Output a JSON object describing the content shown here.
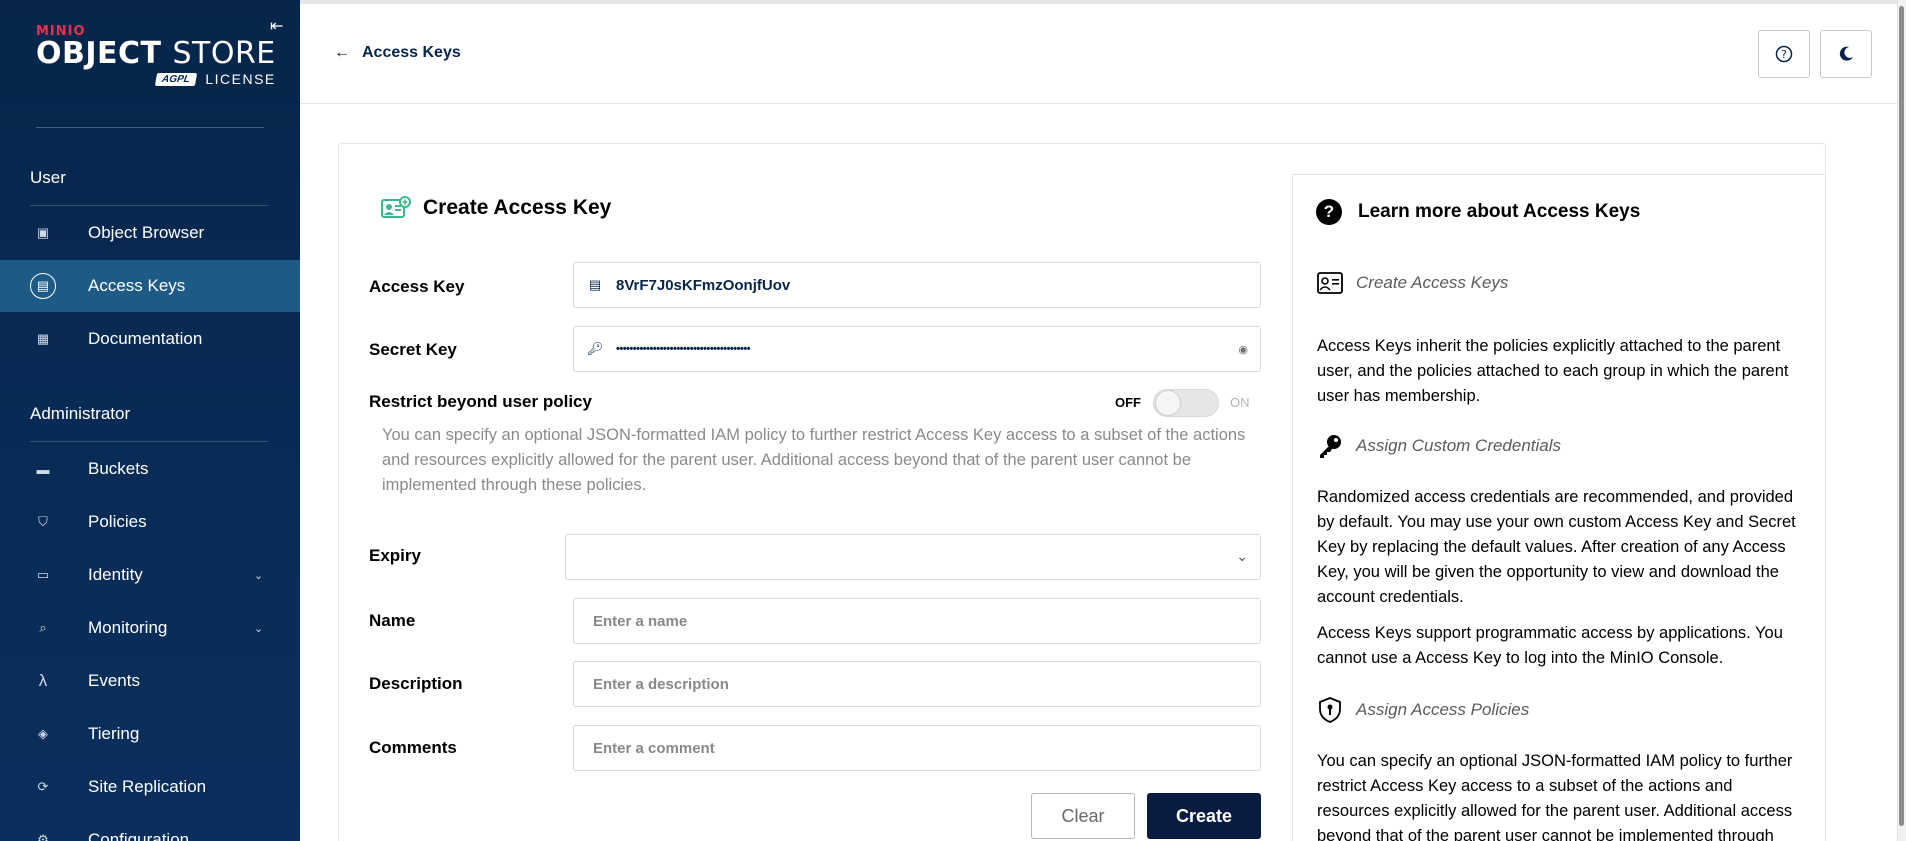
{
  "sidebar": {
    "logo": {
      "brand": "MINIO",
      "product_bold": "OBJECT",
      "product_light": "STORE",
      "badge": "AGPL",
      "license": "LICENSE"
    },
    "sections": {
      "user": "User",
      "admin": "Administrator"
    },
    "items": [
      {
        "label": "Object Browser",
        "icon": "object-browser-icon"
      },
      {
        "label": "Access Keys",
        "icon": "access-keys-icon",
        "active": true
      },
      {
        "label": "Documentation",
        "icon": "documentation-icon"
      },
      {
        "label": "Buckets",
        "icon": "bucket-icon"
      },
      {
        "label": "Policies",
        "icon": "shield-icon"
      },
      {
        "label": "Identity",
        "icon": "identity-icon",
        "expandable": true
      },
      {
        "label": "Monitoring",
        "icon": "monitoring-icon",
        "expandable": true
      },
      {
        "label": "Events",
        "icon": "lambda-icon"
      },
      {
        "label": "Tiering",
        "icon": "layers-icon"
      },
      {
        "label": "Site Replication",
        "icon": "replication-icon"
      },
      {
        "label": "Configuration",
        "icon": "gear-icon"
      }
    ]
  },
  "header": {
    "back_label": "Access Keys"
  },
  "form": {
    "title": "Create Access Key",
    "access_key": {
      "label": "Access Key",
      "value": "8VrF7J0sKFmzOonjfUov"
    },
    "secret_key": {
      "label": "Secret Key",
      "value": "••••••••••••••••••••••••••••••••••••••••"
    },
    "restrict": {
      "label": "Restrict beyond user policy",
      "off_label": "OFF",
      "on_label": "ON",
      "help": "You can specify an optional JSON-formatted IAM policy to further restrict Access Key access to a subset of the actions and resources explicitly allowed for the parent user. Additional access beyond that of the parent user cannot be implemented through these policies."
    },
    "expiry": {
      "label": "Expiry",
      "value": ""
    },
    "name": {
      "label": "Name",
      "placeholder": "Enter a name"
    },
    "description": {
      "label": "Description",
      "placeholder": "Enter a description"
    },
    "comments": {
      "label": "Comments",
      "placeholder": "Enter a comment"
    },
    "clear_label": "Clear",
    "create_label": "Create"
  },
  "help": {
    "title": "Learn more about Access Keys",
    "sections": [
      {
        "heading": "Create Access Keys",
        "paragraphs": [
          "Access Keys inherit the policies explicitly attached to the parent user, and the policies attached to each group in which the parent user has membership."
        ]
      },
      {
        "heading": "Assign Custom Credentials",
        "paragraphs": [
          "Randomized access credentials are recommended, and provided by default. You may use your own custom Access Key and Secret Key by replacing the default values. After creation of any Access Key, you will be given the opportunity to view and download the account credentials.",
          "Access Keys support programmatic access by applications. You cannot use a Access Key to log into the MinIO Console."
        ]
      },
      {
        "heading": "Assign Access Policies",
        "paragraphs": [
          "You can specify an optional JSON-formatted IAM policy to further restrict Access Key access to a subset of the actions and resources explicitly allowed for the parent user. Additional access beyond that of the parent user cannot be implemented through these policies."
        ]
      }
    ]
  },
  "colors": {
    "sidebar_bg": "#07254a",
    "sidebar_active": "#1d5a85",
    "primary_button": "#081c42",
    "brand_red": "#e8334a"
  }
}
